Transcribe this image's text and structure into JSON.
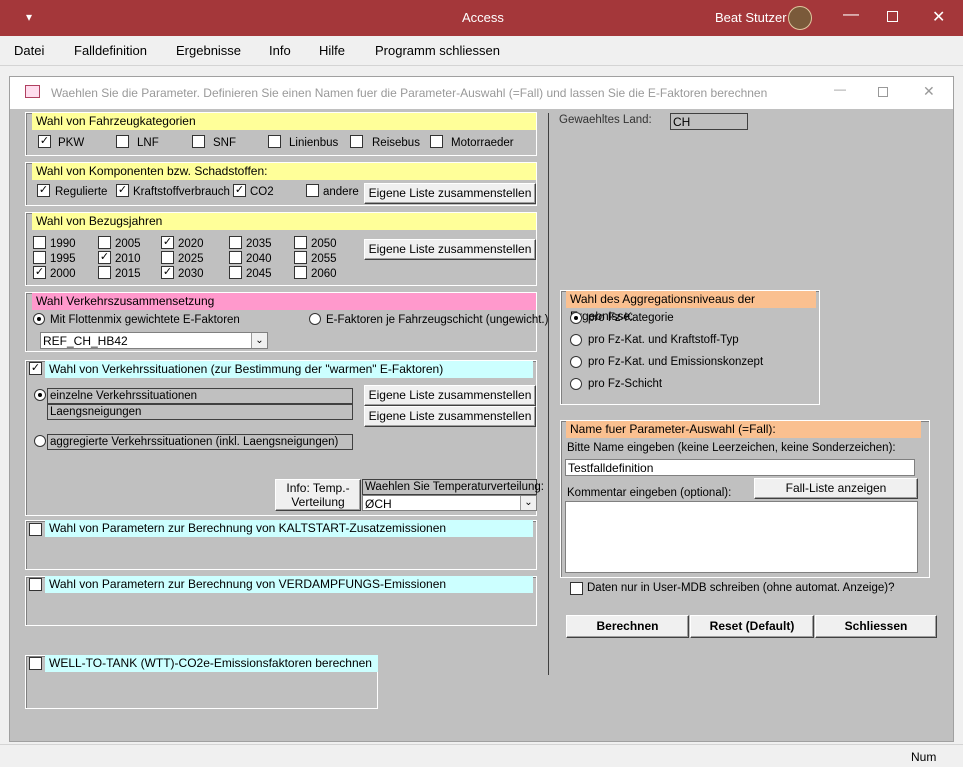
{
  "titlebar": {
    "app": "Access",
    "user": "Beat Stutzer"
  },
  "menu": [
    "Datei",
    "Falldefinition",
    "Ergebnisse",
    "Info",
    "Hilfe",
    "Programm schliessen"
  ],
  "form_title": "Waehlen Sie die Parameter. Definieren Sie einen Namen fuer die Parameter-Auswahl (=Fall) und lassen Sie die E-Faktoren berechnen",
  "vehicle": {
    "header": "Wahl von Fahrzeugkategorien",
    "items": [
      {
        "label": "PKW",
        "checked": true
      },
      {
        "label": "LNF",
        "checked": false
      },
      {
        "label": "SNF",
        "checked": false
      },
      {
        "label": "Linienbus",
        "checked": false
      },
      {
        "label": "Reisebus",
        "checked": false
      },
      {
        "label": "Motorraeder",
        "checked": false
      }
    ]
  },
  "components": {
    "header": "Wahl von Komponenten bzw. Schadstoffen:",
    "items": [
      {
        "label": "Regulierte",
        "checked": true
      },
      {
        "label": "Kraftstoffverbrauch",
        "checked": true
      },
      {
        "label": "CO2",
        "checked": true
      },
      {
        "label": "andere",
        "checked": false
      }
    ],
    "button": "Eigene Liste zusammenstellen"
  },
  "years": {
    "header": "Wahl von Bezugsjahren",
    "items": [
      {
        "label": "1990",
        "checked": false
      },
      {
        "label": "1995",
        "checked": false
      },
      {
        "label": "2000",
        "checked": true
      },
      {
        "label": "2005",
        "checked": false
      },
      {
        "label": "2010",
        "checked": true
      },
      {
        "label": "2015",
        "checked": false
      },
      {
        "label": "2020",
        "checked": true
      },
      {
        "label": "2025",
        "checked": false
      },
      {
        "label": "2030",
        "checked": true
      },
      {
        "label": "2035",
        "checked": false
      },
      {
        "label": "2040",
        "checked": false
      },
      {
        "label": "2045",
        "checked": false
      },
      {
        "label": "2050",
        "checked": false
      },
      {
        "label": "2055",
        "checked": false
      },
      {
        "label": "2060",
        "checked": false
      }
    ],
    "button": "Eigene Liste zusammenstellen"
  },
  "traffic": {
    "header": "Wahl Verkehrszusammensetzung",
    "opt1": "Mit Flottenmix gewichtete E-Faktoren",
    "opt2": "E-Faktoren je Fahrzeugschicht (ungewicht.)",
    "dropdown": "REF_CH_HB42"
  },
  "situations": {
    "header": "Wahl von Verkehrssituationen (zur Bestimmung der \"warmen\" E-Faktoren)",
    "checked": true,
    "opt1": "einzelne Verkehrssituationen",
    "opt1_sub": "Laengsneigungen",
    "opt2": "aggregierte Verkehrssituationen (inkl. Laengsneigungen)",
    "button1": "Eigene Liste zusammenstellen",
    "button2": "Eigene Liste zusammenstellen",
    "info_button": "Info: Temp.-Verteilung",
    "temp_label": "Waehlen Sie Temperaturverteilung:",
    "temp_value": "ØCH"
  },
  "coldstart": {
    "header": "Wahl von Parametern zur Berechnung von KALTSTART-Zusatzemissionen"
  },
  "evap": {
    "header": "Wahl von Parametern zur Berechnung von VERDAMPFUNGS-Emissionen"
  },
  "wtt": {
    "header": "WELL-TO-TANK (WTT)-CO2e-Emissionsfaktoren berechnen"
  },
  "country": {
    "label": "Gewaehltes Land:",
    "value": "CH"
  },
  "aggregation": {
    "header": "Wahl des Aggregationsniveaus der Ergebnisse:",
    "options": [
      "pro Fz-Kategorie",
      "pro Fz-Kat. und Kraftstoff-Typ",
      "pro Fz-Kat. und Emissionskonzept",
      "pro Fz-Schicht"
    ],
    "selected": 0
  },
  "name": {
    "header": "Name fuer Parameter-Auswahl (=Fall):",
    "prompt": "Bitte Name eingeben (keine Leerzeichen, keine Sonderzeichen):",
    "value": "Testfalldefinition",
    "comment_label": "Kommentar eingeben (optional):",
    "list_button": "Fall-Liste anzeigen",
    "comment": ""
  },
  "usermdb": {
    "label": "Daten nur in User-MDB schreiben (ohne automat. Anzeige)?",
    "checked": false
  },
  "buttons": {
    "compute": "Berechnen",
    "reset": "Reset (Default)",
    "close": "Schliessen"
  },
  "status": "Num"
}
